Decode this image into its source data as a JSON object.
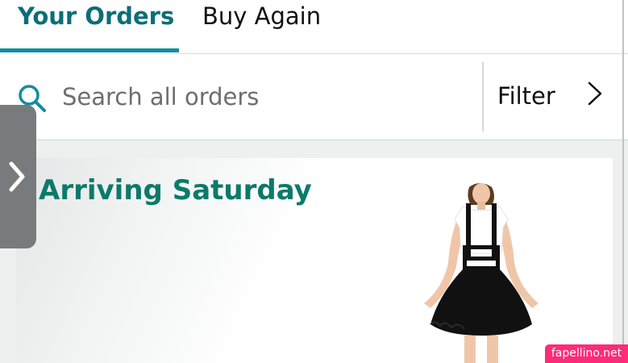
{
  "tabs": {
    "orders_label": "Your Orders",
    "buy_again_label": "Buy Again"
  },
  "search": {
    "placeholder": "Search all orders",
    "filter_label": "Filter"
  },
  "order": {
    "arrival_text": "Arriving Saturday"
  },
  "watermark": {
    "text": "fapellino.net"
  },
  "colors": {
    "accent": "#0f8ea0",
    "arrival_green": "#0b7a6a",
    "active_tab": "#0b6e78"
  },
  "icons": {
    "search": "search-icon",
    "filter_chevron": "chevron-right-icon",
    "handle": "chevron-right-icon"
  }
}
